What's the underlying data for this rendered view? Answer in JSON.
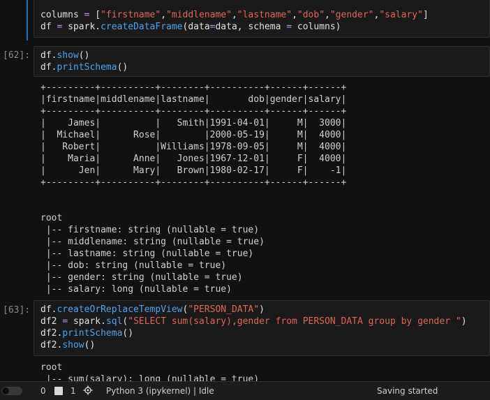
{
  "cells": [
    {
      "prompt": "",
      "code": [
        [
          [
            "var",
            "columns "
          ],
          [
            "op",
            "="
          ],
          [
            "var",
            " ["
          ],
          [
            "str",
            "\"firstname\""
          ],
          [
            "var",
            ","
          ],
          [
            "str",
            "\"middlename\""
          ],
          [
            "var",
            ","
          ],
          [
            "str",
            "\"lastname\""
          ],
          [
            "var",
            ","
          ],
          [
            "str",
            "\"dob\""
          ],
          [
            "var",
            ","
          ],
          [
            "str",
            "\"gender\""
          ],
          [
            "var",
            ","
          ],
          [
            "str",
            "\"salary\""
          ],
          [
            "var",
            "]"
          ]
        ],
        [
          [
            "var",
            "df "
          ],
          [
            "op",
            "="
          ],
          [
            "var",
            " spark."
          ],
          [
            "fn",
            "createDataFrame"
          ],
          [
            "var",
            "(data"
          ],
          [
            "op",
            "="
          ],
          [
            "var",
            "data, schema "
          ],
          [
            "op",
            "="
          ],
          [
            "var",
            " columns)"
          ]
        ]
      ]
    },
    {
      "prompt": "[62]:",
      "code": [
        [
          [
            "var",
            "df."
          ],
          [
            "fn",
            "show"
          ],
          [
            "var",
            "()"
          ]
        ],
        [
          [
            "var",
            "df."
          ],
          [
            "fn",
            "printSchema"
          ],
          [
            "var",
            "()"
          ]
        ]
      ],
      "output": [
        "+---------+----------+--------+----------+------+------+",
        "|firstname|middlename|lastname|       dob|gender|salary|",
        "+---------+----------+--------+----------+------+------+",
        "|    James|          |   Smith|1991-04-01|     M|  3000|",
        "|  Michael|      Rose|        |2000-05-19|     M|  4000|",
        "|   Robert|          |Williams|1978-09-05|     M|  4000|",
        "|    Maria|      Anne|   Jones|1967-12-01|     F|  4000|",
        "|      Jen|      Mary|   Brown|1980-02-17|     F|    -1|",
        "+---------+----------+--------+----------+------+------+",
        "",
        "",
        "root",
        " |-- firstname: string (nullable = true)",
        " |-- middlename: string (nullable = true)",
        " |-- lastname: string (nullable = true)",
        " |-- dob: string (nullable = true)",
        " |-- gender: string (nullable = true)",
        " |-- salary: long (nullable = true)"
      ]
    },
    {
      "prompt": "[63]:",
      "code": [
        [
          [
            "var",
            "df."
          ],
          [
            "fn",
            "createOrReplaceTempView"
          ],
          [
            "var",
            "("
          ],
          [
            "str",
            "\"PERSON_DATA\""
          ],
          [
            "var",
            ")"
          ]
        ],
        [
          [
            "var",
            "df2 "
          ],
          [
            "op",
            "="
          ],
          [
            "var",
            " spark."
          ],
          [
            "fn",
            "sql"
          ],
          [
            "var",
            "("
          ],
          [
            "str",
            "\"SELECT sum(salary),gender from PERSON_DATA group by gender \""
          ],
          [
            "var",
            ")"
          ]
        ],
        [
          [
            "var",
            "df2."
          ],
          [
            "fn",
            "printSchema"
          ],
          [
            "var",
            "()"
          ]
        ],
        [
          [
            "var",
            "df2."
          ],
          [
            "fn",
            "show"
          ],
          [
            "var",
            "()"
          ]
        ]
      ],
      "output": [
        "root",
        " |-- sum(salary): long (nullable = true)"
      ]
    }
  ],
  "status": {
    "count_a": "0",
    "count_b": "1",
    "kernel": "Python 3 (ipykernel) | Idle",
    "message": "Saving started"
  },
  "colors": {
    "accent": "#1e72b8",
    "function": "#4fa3e8",
    "string": "#e0645c",
    "operator": "#c792ea"
  }
}
